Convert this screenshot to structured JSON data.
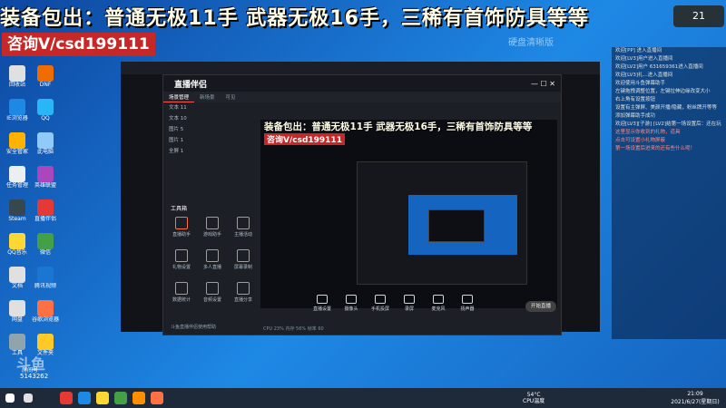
{
  "overlay": {
    "banner": "装备包出：普通无极11手 武器无极16手，三稀有首饰防具等等",
    "contact": "咨询V/csd199111",
    "clear_mode": "硬盘清晰版",
    "weather_temp": "21"
  },
  "desktop_icons": [
    {
      "label": "回收站",
      "color": "#e0e0e0"
    },
    {
      "label": "DNF",
      "color": "#ef6c00"
    },
    {
      "label": "IE浏览器",
      "color": "#1e88e5"
    },
    {
      "label": "QQ",
      "color": "#29b6f6"
    },
    {
      "label": "安全管家",
      "color": "#ffb300"
    },
    {
      "label": "此电脑",
      "color": "#90caf9"
    },
    {
      "label": "任务管理",
      "color": "#eceff1"
    },
    {
      "label": "英雄联盟",
      "color": "#ab47bc"
    },
    {
      "label": "Steam",
      "color": "#37474f"
    },
    {
      "label": "直播伴侣",
      "color": "#e53935"
    },
    {
      "label": "QQ音乐",
      "color": "#fdd835"
    },
    {
      "label": "微信",
      "color": "#43a047"
    },
    {
      "label": "文档",
      "color": "#e0e0e0"
    },
    {
      "label": "腾讯视频",
      "color": "#1976d2"
    },
    {
      "label": "网盘",
      "color": "#e0e0e0"
    },
    {
      "label": "谷歌浏览器",
      "color": "#ff7043"
    },
    {
      "label": "工具",
      "color": "#90a4ae"
    },
    {
      "label": "文件夹",
      "color": "#ffca28"
    }
  ],
  "chat": {
    "lines": [
      "欢迎[PP] 进入直播间",
      "欢迎[LV3]用户进入直播间",
      "欢迎[LV2]用户 631659361进入直播间",
      "欢迎[LV3]礼...进入直播间",
      "",
      "欢迎使用斗鱼弹幕助手",
      "左键拖拽调整位置，左键拉伸边缘改变大小",
      "",
      "右上角有设置按钮",
      "设置有主弹屏、美颜开播/隐藏，粉丝牌开等等",
      "添加弹幕助手成功",
      "",
      "欢迎[LV3][子游] [LV2]结第一场设置后：还在玩",
      "",
      "",
      "",
      "",
      "这里显示你收到的礼物，道具",
      "点击可设置小礼物屏蔽",
      "第一场设置后进来的还有些什么呢！"
    ]
  },
  "app": {
    "logo": "直播伴侣",
    "tabs": [
      "场景管理",
      "新场景",
      "可见"
    ],
    "scenes": [
      "文本 11",
      "文本 10",
      "图片 5",
      "图片 1",
      "全屏 1"
    ],
    "toolbox_title": "工具箱",
    "tools": [
      "直播助手",
      "游戏助手",
      "主播活动",
      "礼物设置",
      "多人直播",
      "屏幕录制",
      "数据统计",
      "音频设置",
      "直播分享"
    ],
    "footer_note": "斗鱼直播伴侣使用帮助",
    "bottom_buttons": [
      "直播设置",
      "摄像头",
      "手机投屏",
      "录屏",
      "麦克风",
      "扬声器"
    ],
    "start_live": "开始直播",
    "status": "CPU 23%   内存 56%   帧率 60"
  },
  "watermark": {
    "brand": "斗鱼",
    "room_label": "房间号",
    "room": "5143262"
  },
  "taskbar": {
    "weather": "54°C",
    "weather_sub": "CPU温度",
    "time": "21:09",
    "date": "2021/6/27(星期日)"
  }
}
